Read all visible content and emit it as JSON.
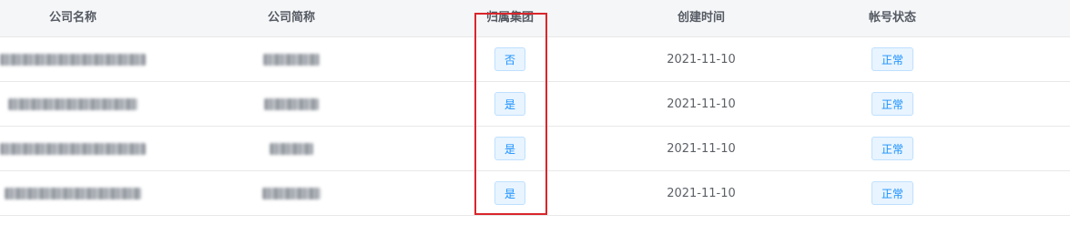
{
  "table": {
    "columns": [
      {
        "key": "company_name",
        "label": "公司名称"
      },
      {
        "key": "company_short",
        "label": "公司简称"
      },
      {
        "key": "group",
        "label": "归属集团"
      },
      {
        "key": "created",
        "label": "创建时间"
      },
      {
        "key": "status",
        "label": "帐号状态"
      }
    ],
    "rows": [
      {
        "group": "否",
        "created": "2021-11-10",
        "status": "正常"
      },
      {
        "group": "是",
        "created": "2021-11-10",
        "status": "正常"
      },
      {
        "group": "是",
        "created": "2021-11-10",
        "status": "正常"
      },
      {
        "group": "是",
        "created": "2021-11-10",
        "status": "正常"
      }
    ]
  },
  "colors": {
    "highlight_border": "#d9262b",
    "tag_text": "#1890ff",
    "tag_background": "#e8f4ff",
    "header_background": "#f5f6f8"
  }
}
